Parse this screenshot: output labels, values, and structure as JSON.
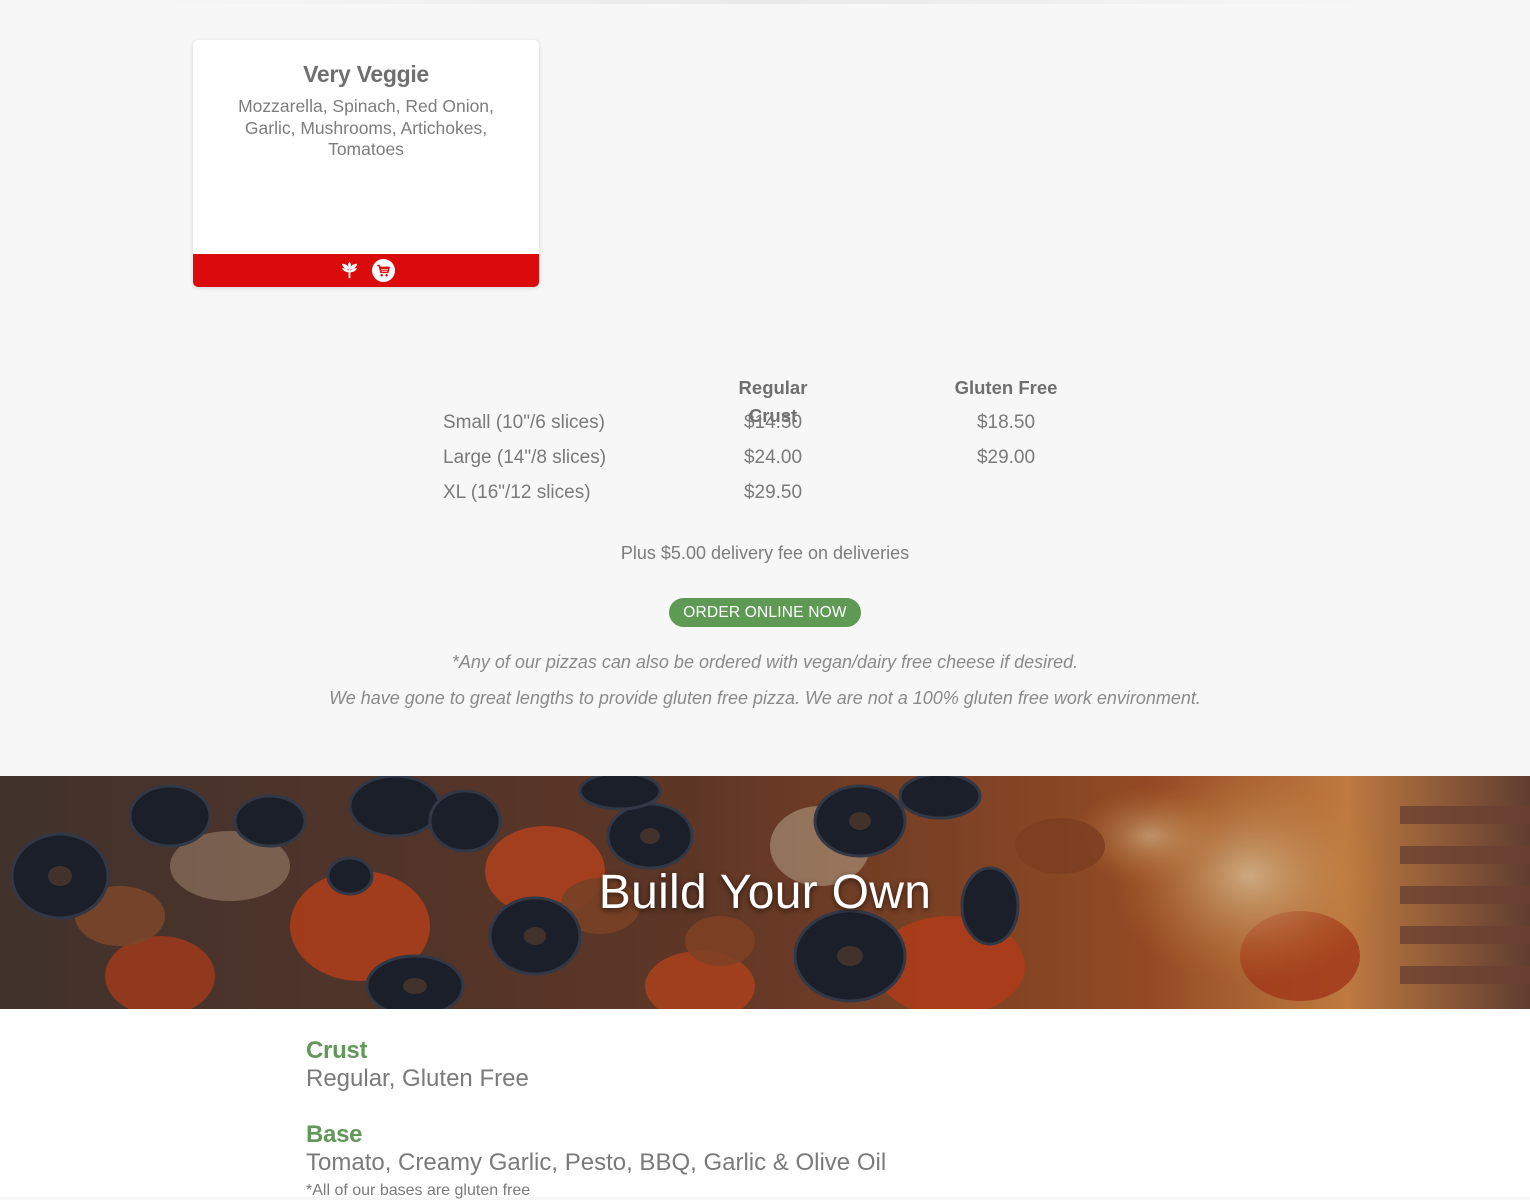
{
  "card": {
    "title": "Very Veggie",
    "description": "Mozzarella, Spinach, Red Onion, Garlic, Mushrooms, Artichokes, Tomatoes",
    "footer_color": "#db0b0b",
    "icons": [
      "veggie-icon",
      "cart-icon"
    ]
  },
  "pricing": {
    "headers": [
      "",
      "Regular Crust",
      "Gluten Free"
    ],
    "rows": [
      {
        "size": "Small (10\"/6 slices)",
        "regular": "$14.50",
        "gluten_free": "$18.50"
      },
      {
        "size": "Large (14\"/8 slices)",
        "regular": "$24.00",
        "gluten_free": "$29.00"
      },
      {
        "size": "XL (16\"/12 slices)",
        "regular": "$29.50",
        "gluten_free": ""
      }
    ]
  },
  "delivery_note": "Plus $5.00 delivery fee on deliveries",
  "order_button": {
    "label": "ORDER ONLINE NOW",
    "color": "#5f9a55"
  },
  "notes": {
    "vegan": "*Any of our pizzas can also be ordered with vegan/dairy free cheese if desired.",
    "gluten": "We have gone to great lengths to provide gluten free pizza. We are not a 100% gluten free work environment."
  },
  "banner": {
    "title": "Build Your Own"
  },
  "build_your_own": {
    "crust": {
      "heading": "Crust",
      "options": "Regular, Gluten Free"
    },
    "base": {
      "heading": "Base",
      "options": "Tomato, Creamy Garlic, Pesto, BBQ, Garlic & Olive Oil",
      "note": "*All of our bases are gluten free"
    },
    "accent_color": "#62975a"
  }
}
